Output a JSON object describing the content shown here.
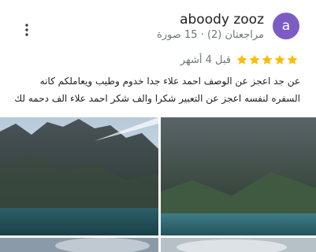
{
  "review": {
    "avatar_letter": "a",
    "avatar_color": "#7c5cc4",
    "user_name": "aboody zooz",
    "user_meta": "مراجعتان (2) · 15 صورة",
    "rating": 5,
    "star_color": "#fbbc04",
    "relative_time": "قبل 4 أشهر",
    "text": "عن جد اعجز عن الوصف احمد علاء جدا خدوم وطيب ويعاملكم كانه السفره لنفسه اعجز عن التعبير شكرا والف شكر احمد علاء الف دحمه لك",
    "more_icon": "more-vert-icon",
    "photos": [
      "lake-mountains-photo",
      "lake-mountains-photo",
      "sky-photo",
      "sky-photo"
    ]
  }
}
